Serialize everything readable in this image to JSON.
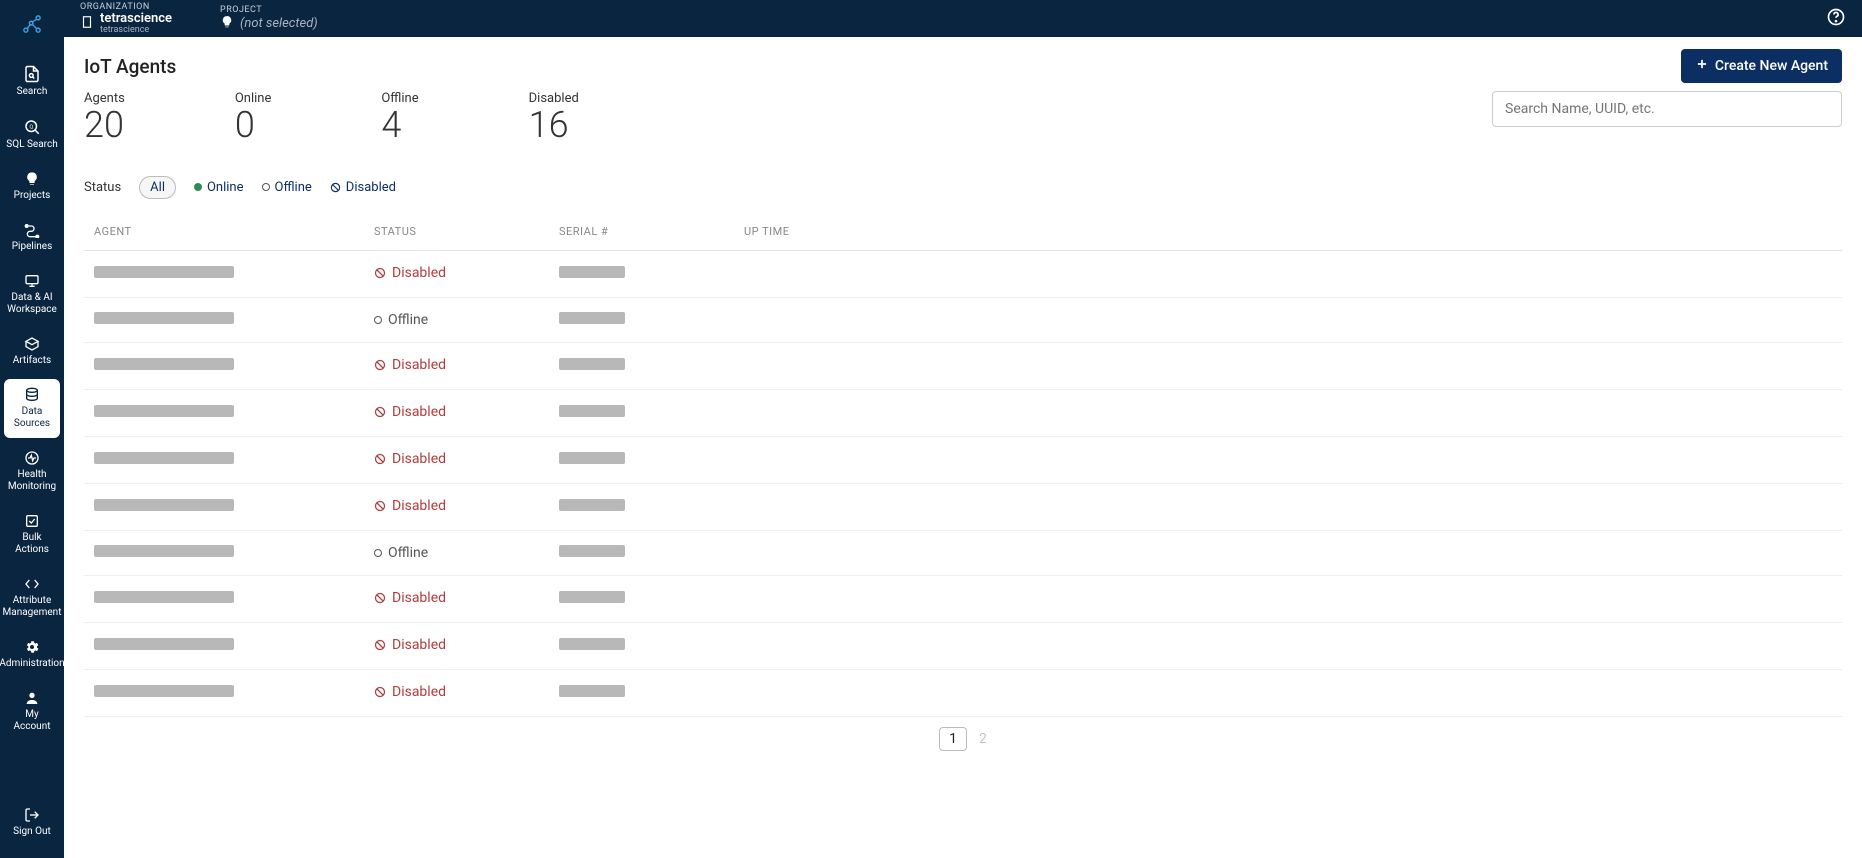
{
  "header": {
    "org_label": "ORGANIZATION",
    "org_title": "tetrascience",
    "org_sub": "tetrascience",
    "project_label": "PROJECT",
    "project_value": "(not selected)"
  },
  "sidebar": {
    "items": [
      {
        "id": "search",
        "label": "Search"
      },
      {
        "id": "sql-search",
        "label": "SQL Search"
      },
      {
        "id": "projects",
        "label": "Projects"
      },
      {
        "id": "pipelines",
        "label": "Pipelines"
      },
      {
        "id": "data-ai-workspace",
        "label": "Data & AI Workspace"
      },
      {
        "id": "artifacts",
        "label": "Artifacts"
      },
      {
        "id": "data-sources",
        "label": "Data Sources"
      },
      {
        "id": "health-monitoring",
        "label": "Health Monitoring"
      },
      {
        "id": "bulk-actions",
        "label": "Bulk Actions"
      },
      {
        "id": "attribute-management",
        "label": "Attribute Management"
      },
      {
        "id": "administration",
        "label": "Administration"
      },
      {
        "id": "my-account",
        "label": "My Account"
      }
    ],
    "sign_out": "Sign Out"
  },
  "page": {
    "title": "IoT Agents",
    "create_button": "Create New Agent"
  },
  "stats": {
    "agents_label": "Agents",
    "agents_value": "20",
    "online_label": "Online",
    "online_value": "0",
    "offline_label": "Offline",
    "offline_value": "4",
    "disabled_label": "Disabled",
    "disabled_value": "16"
  },
  "search": {
    "placeholder": "Search Name, UUID, etc."
  },
  "filters": {
    "label": "Status",
    "all": "All",
    "online": "Online",
    "offline": "Offline",
    "disabled": "Disabled"
  },
  "table": {
    "columns": {
      "agent": "AGENT",
      "status": "STATUS",
      "serial": "SERIAL #",
      "uptime": "UP TIME"
    },
    "status_labels": {
      "disabled": "Disabled",
      "offline": "Offline"
    },
    "rows": [
      {
        "status": "disabled"
      },
      {
        "status": "offline"
      },
      {
        "status": "disabled"
      },
      {
        "status": "disabled"
      },
      {
        "status": "disabled"
      },
      {
        "status": "disabled"
      },
      {
        "status": "offline"
      },
      {
        "status": "disabled"
      },
      {
        "status": "disabled"
      },
      {
        "status": "disabled"
      }
    ]
  },
  "pagination": {
    "current": "1",
    "next_partial": "2"
  }
}
